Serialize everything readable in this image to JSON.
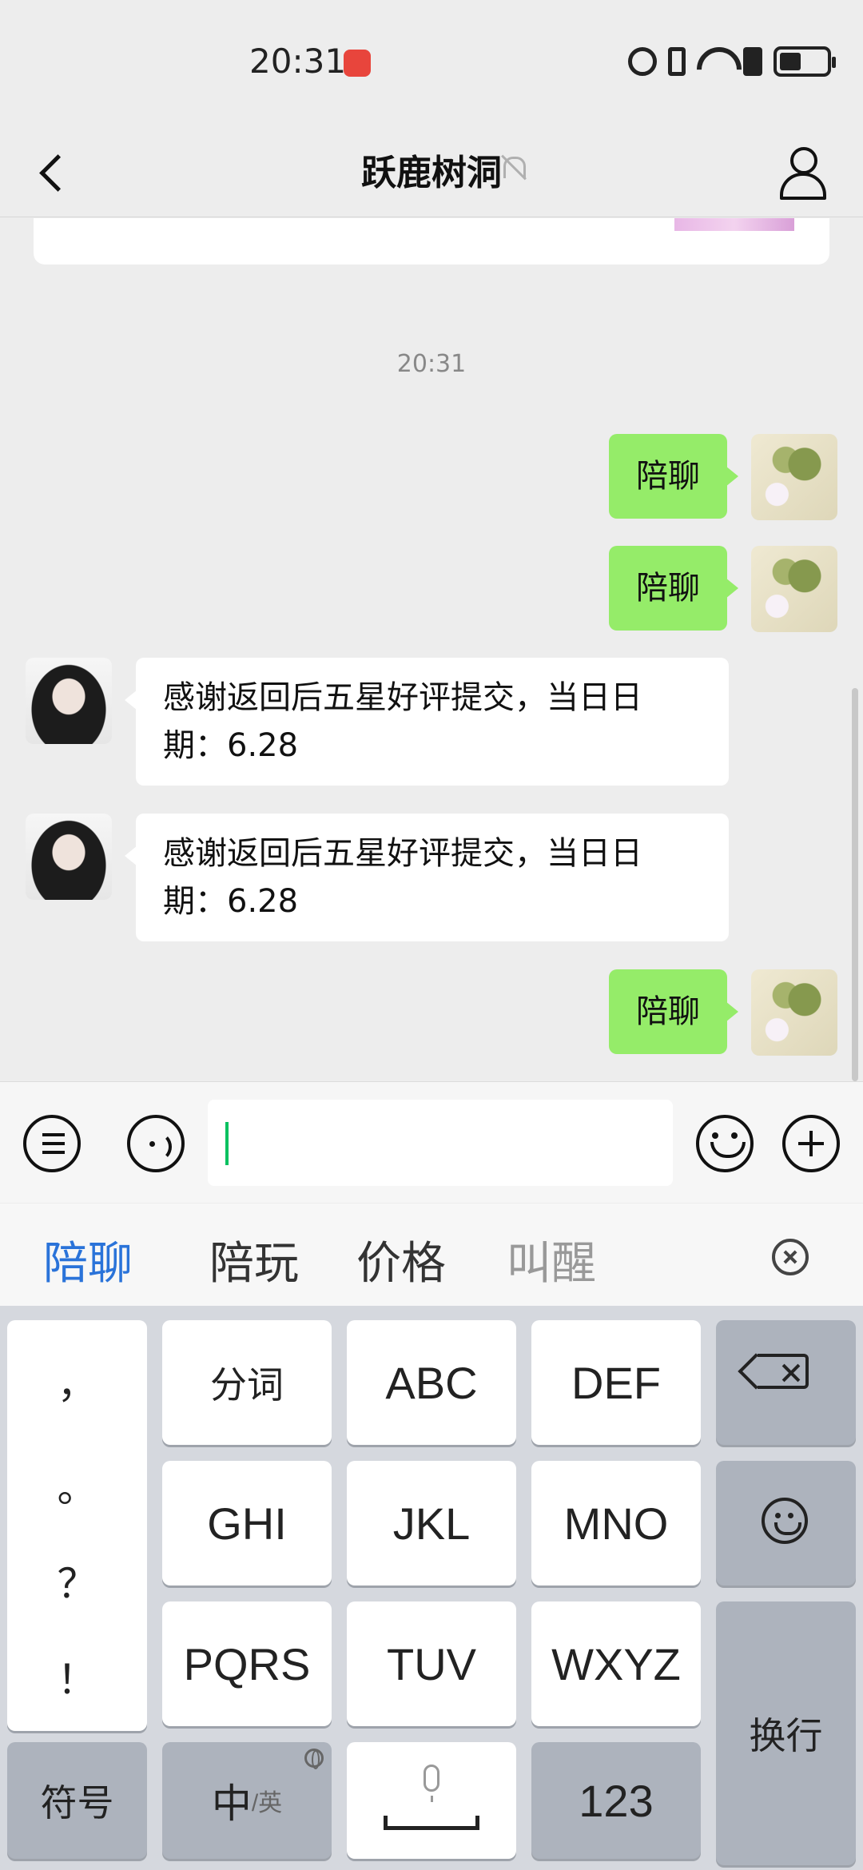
{
  "status_bar": {
    "time": "20:31",
    "icons": [
      "app-badge-icon",
      "alarm-icon",
      "vibrate-icon",
      "wifi-icon",
      "alert-icon",
      "battery-icon"
    ]
  },
  "header": {
    "title": "跃鹿树洞",
    "icons": [
      "back-icon",
      "mute-icon",
      "profile-icon"
    ]
  },
  "chat": {
    "timestamp": "20:31",
    "messages": [
      {
        "from": "me",
        "text": "陪聊"
      },
      {
        "from": "me",
        "text": "陪聊"
      },
      {
        "from": "other",
        "line1": "感谢返回后五星好评提交，当日日",
        "line2": "期：6.28"
      },
      {
        "from": "other",
        "line1": "感谢返回后五星好评提交，当日日",
        "line2": "期：6.28"
      },
      {
        "from": "me",
        "text": "陪聊"
      }
    ]
  },
  "input_bar": {
    "value": "",
    "icons": [
      "menu-icon",
      "voice-icon",
      "emoji-icon",
      "plus-icon"
    ]
  },
  "candidates": {
    "items": [
      "陪聊",
      "陪玩",
      "价格",
      "叫醒"
    ],
    "selected_index": 0
  },
  "keyboard": {
    "punctuation": [
      "，",
      "。",
      "？",
      "！"
    ],
    "row1": [
      "分词",
      "ABC",
      "DEF"
    ],
    "row2": [
      "GHI",
      "JKL",
      "MNO"
    ],
    "row3": [
      "PQRS",
      "TUV",
      "WXYZ"
    ],
    "bottom": {
      "symbols": "符号",
      "lang_main": "中",
      "lang_sub": "/英",
      "numbers": "123",
      "enter": "换行"
    },
    "colors": {
      "keyboard_bg": "#d5d8de",
      "key": "#ffffff",
      "func_key": "#adb3bd"
    }
  },
  "colors": {
    "my_bubble": "#95ec69",
    "their_bubble": "#ffffff",
    "chat_bg": "#ededed",
    "candidate_selected": "#2a73d9",
    "cursor": "#07c160"
  }
}
